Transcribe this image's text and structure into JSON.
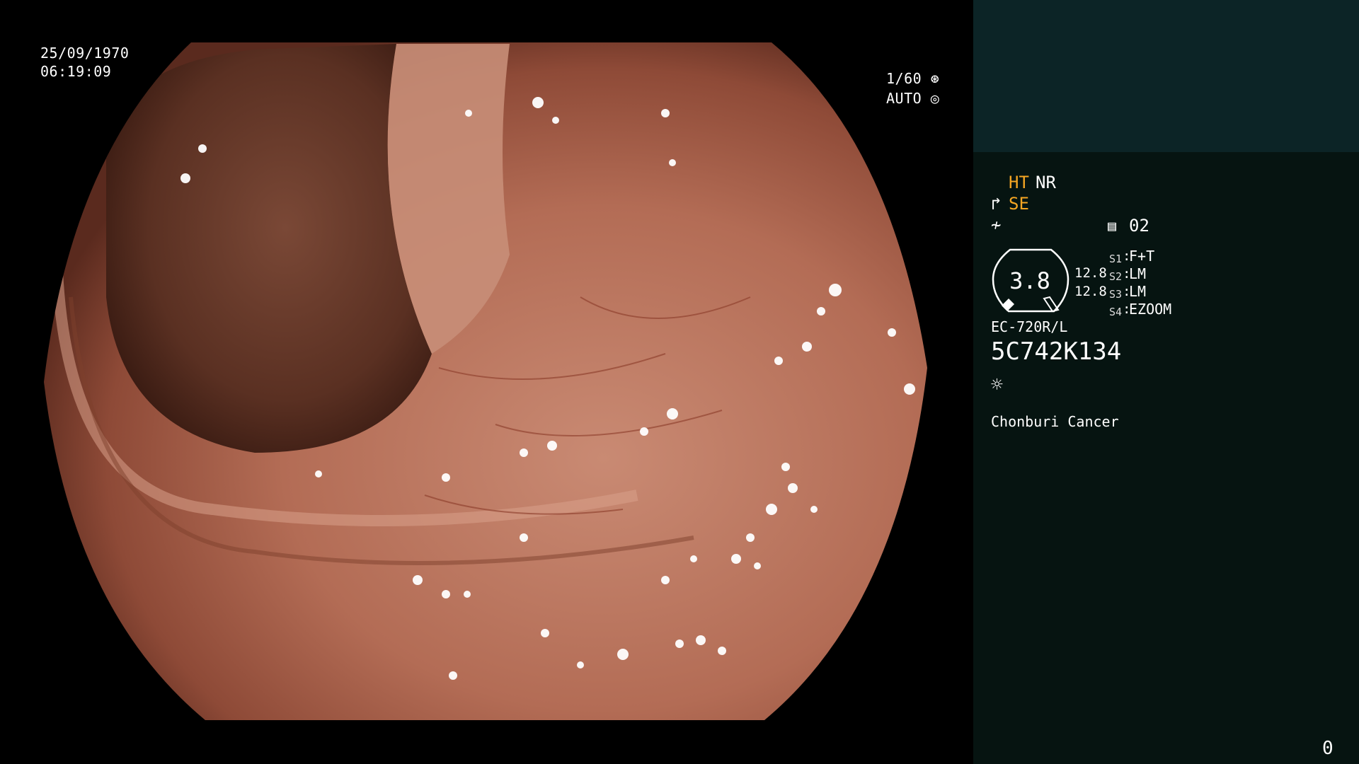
{
  "viewport": {
    "date": "25/09/1970",
    "time": "06:19:09",
    "shutter": "1/60",
    "mode": "AUTO",
    "shutter_icon": "shutter-icon",
    "auto_icon": "iris-icon"
  },
  "panel": {
    "ht": "HT",
    "nr": "NR",
    "se": "SE",
    "se_icon": "enhance-icon",
    "struct_icon": "structure-icon",
    "memory_icon": "memory-icon",
    "memory_value": "02",
    "gauge_value": "3.8",
    "gauge_right_top": "12.8",
    "gauge_right_bottom": "12.8",
    "switches": [
      {
        "key": "S1",
        "value": "F+T"
      },
      {
        "key": "S2",
        "value": "LM"
      },
      {
        "key": "S3",
        "value": "LM"
      },
      {
        "key": "S4",
        "value": "EZOOM"
      }
    ],
    "scope_model": "EC-720R/L",
    "serial": "5C742K134",
    "light_icon": "light-icon",
    "institution": "Chonburi Cancer",
    "counter": "0"
  },
  "colors": {
    "panel_bg": "#061411",
    "panel_top_bg": "#0c2426",
    "accent_orange": "#f5a623",
    "tissue": "#b8705a"
  }
}
